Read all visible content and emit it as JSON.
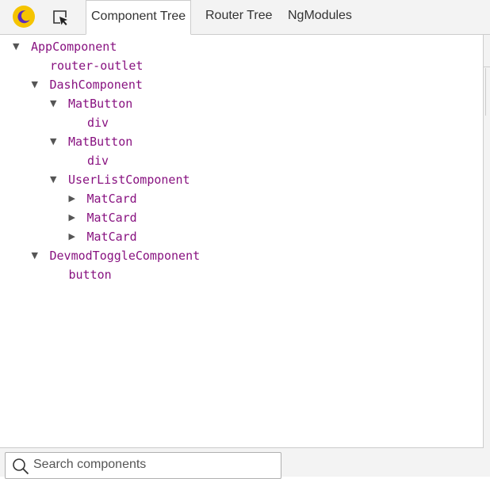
{
  "toolbar": {
    "theme_toggle_icon": "moon-icon",
    "inspect_icon": "cursor-select-icon",
    "tabs": [
      {
        "label": "Component Tree",
        "active": true
      },
      {
        "label": "Router Tree",
        "active": false
      },
      {
        "label": "NgModules",
        "active": false
      }
    ]
  },
  "tree": {
    "expanded_caret": "▼",
    "collapsed_caret": "▶",
    "nodes": [
      {
        "label": "AppComponent",
        "depth": 0,
        "state": "expanded"
      },
      {
        "label": "router-outlet",
        "depth": 1,
        "state": "leaf"
      },
      {
        "label": "DashComponent",
        "depth": 1,
        "state": "expanded"
      },
      {
        "label": "MatButton",
        "depth": 2,
        "state": "expanded"
      },
      {
        "label": "div",
        "depth": 3,
        "state": "leaf"
      },
      {
        "label": "MatButton",
        "depth": 2,
        "state": "expanded"
      },
      {
        "label": "div",
        "depth": 3,
        "state": "leaf"
      },
      {
        "label": "UserListComponent",
        "depth": 2,
        "state": "expanded"
      },
      {
        "label": "MatCard",
        "depth": 3,
        "state": "collapsed"
      },
      {
        "label": "MatCard",
        "depth": 3,
        "state": "collapsed"
      },
      {
        "label": "MatCard",
        "depth": 3,
        "state": "collapsed"
      },
      {
        "label": "DevmodToggleComponent",
        "depth": 1,
        "state": "expanded"
      },
      {
        "label": "button",
        "depth": 2,
        "state": "leaf"
      }
    ]
  },
  "search": {
    "placeholder": "Search components",
    "value": ""
  },
  "colors": {
    "node_text": "#881280",
    "theme_icon_bg": "#f5c400",
    "theme_icon_fg": "#5a2bbd"
  }
}
